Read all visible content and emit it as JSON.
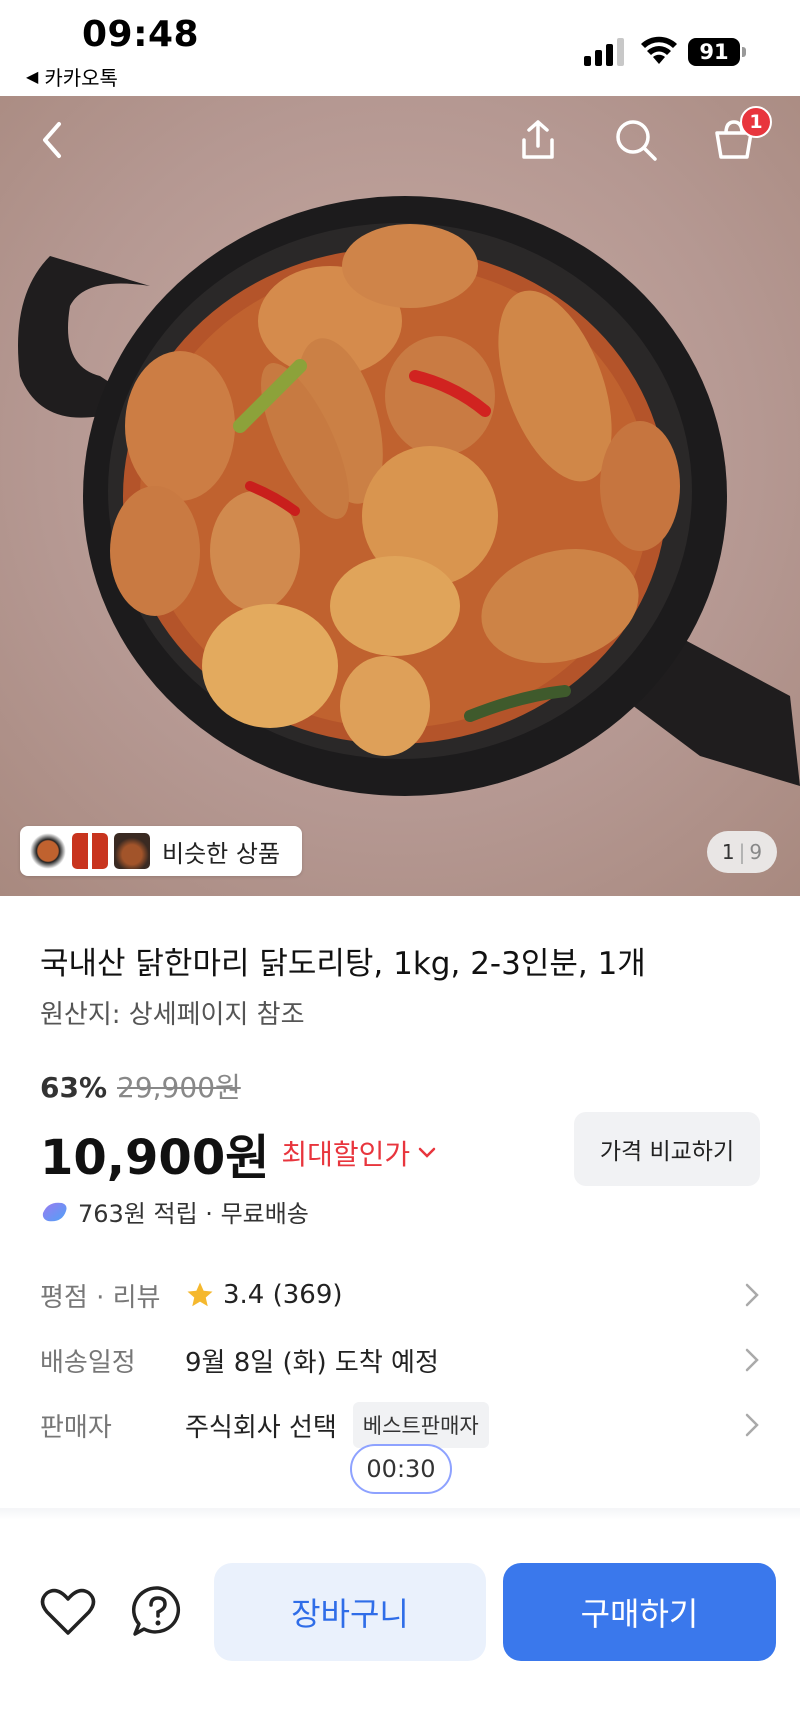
{
  "status_bar": {
    "time": "09:48",
    "back_app": "카카오톡",
    "battery": "91"
  },
  "hero": {
    "icons": [
      "back-icon",
      "share-icon",
      "search-icon",
      "cart-icon"
    ],
    "cart_badge": "1",
    "similar_label": "비슷한 상품",
    "page_current": "1",
    "page_total": "9"
  },
  "product": {
    "title": "국내산 닭한마리 닭도리탕, 1kg, 2-3인분, 1개",
    "origin": "원산지: 상세페이지 참조",
    "discount_pct": "63%",
    "original_price": "29,900원",
    "price": "10,900원",
    "max_discount_label": "최대할인가",
    "compare_button": "가격 비교하기",
    "reward_text": "763원 적립 · 무료배송"
  },
  "details": {
    "rating_label": "평점 · 리뷰",
    "rating_value": "3.4 (369)",
    "delivery_label": "배송일정",
    "delivery_value": "9월 8일 (화) 도착 예정",
    "seller_label": "판매자",
    "seller_value": "주식회사 선택",
    "seller_badge": "베스트판매자",
    "timer": "00:30"
  },
  "bottom_bar": {
    "cart_button": "장바구니",
    "buy_button": "구매하기"
  },
  "colors": {
    "accent_blue": "#3a78ec",
    "sale_red": "#e8353d",
    "star": "#f5b82e"
  }
}
